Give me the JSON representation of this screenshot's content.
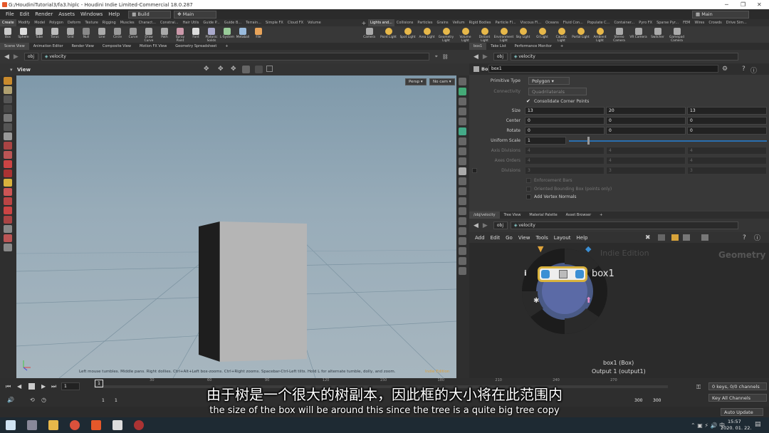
{
  "window": {
    "title": "G:/HoudiniTutorial3/fa3.hiplc - Houdini Indie Limited-Commercial 18.0.287"
  },
  "menu": {
    "items": [
      "File",
      "Edit",
      "Render",
      "Assets",
      "Windows",
      "Help"
    ],
    "build_desktop": "Build",
    "main_desktop": "Main",
    "main_desktop_right": "Main"
  },
  "shelf_tabs_left": [
    "Create",
    "Modify",
    "Model",
    "Polygon",
    "Deform",
    "Texture",
    "Rigging",
    "Muscles",
    "Charact...",
    "Constrai...",
    "Hair Utils",
    "Guide P...",
    "Guide B...",
    "Terrain...",
    "Simple FX",
    "Cloud FX",
    "Volume"
  ],
  "shelf_tabs_right": [
    "Lights and...",
    "Collisions",
    "Particles",
    "Grains",
    "Vellum",
    "Rigid Bodies",
    "Particle Fl...",
    "Viscous Fl...",
    "Oceans",
    "Fluid Con...",
    "Populate C...",
    "Container...",
    "Pyro FX",
    "Sparse Pyr...",
    "FEM",
    "Wires",
    "Crowds",
    "Drive Sim..."
  ],
  "shelf_tools": [
    "Box",
    "Sphere",
    "Tube",
    "Torus",
    "Grid",
    "Null",
    "Line",
    "Circle",
    "Curve",
    "Draw Curve",
    "Path",
    "Spray Paint",
    "Font",
    "Platonic Solids",
    "L-System",
    "Metaball",
    "File"
  ],
  "light_tools": [
    "Camera",
    "Point Light",
    "Spot Light",
    "Area Light",
    "Geometry Light",
    "Volume Light",
    "Distant Light",
    "Environment Light",
    "Sky Light",
    "GI Light",
    "Caustic Light",
    "Portal Light",
    "Ambient Light",
    "Stereo Camera",
    "VR Camera",
    "Switcher",
    "Gamepad Camera"
  ],
  "viewer": {
    "tabs": [
      "Scene View",
      "Animation Editor",
      "Render View",
      "Composite View",
      "Motion FX View",
      "Geometry Spreadsheet"
    ],
    "path_obj": "obj",
    "path_node": "velocity",
    "title": "View",
    "persp": "Persp",
    "cam": "No cam",
    "status": "Left mouse tumbles. Middle pans. Right dollies. Ctrl+Alt+Left box-zooms. Ctrl+Right zooms. Spacebar-Ctrl-Left tilts. Hold L for alternate tumble, dolly, and zoom.",
    "indie": "Indie Edition"
  },
  "params": {
    "tabs": [
      "box1",
      "Take List",
      "Performance Monitor"
    ],
    "path_obj": "obj",
    "path_node": "velocity",
    "node_type": "Box",
    "node_name": "box1",
    "primitive_type_label": "Primitive Type",
    "primitive_type_value": "Polygon",
    "connectivity_label": "Connectivity",
    "connectivity_value": "Quadrilaterals",
    "consolidate_label": "Consolidate Corner Points",
    "size_label": "Size",
    "size": [
      "13",
      "20",
      "13"
    ],
    "center_label": "Center",
    "center": [
      "0",
      "0",
      "0"
    ],
    "rotate_label": "Rotate",
    "rotate": [
      "0",
      "0",
      "0"
    ],
    "uniform_scale_label": "Uniform Scale",
    "uniform_scale": "1",
    "axis_divisions_label": "Axis Divisions",
    "axis_divisions": [
      "4",
      "4",
      "4"
    ],
    "axes_orders_label": "Axes Orders",
    "axes_orders": [
      "4",
      "4",
      "4"
    ],
    "divisions_label": "Divisions",
    "divisions": [
      "3",
      "3",
      "3"
    ],
    "enforcement_bars": "Enforcement Bars",
    "oriented_bbox": "Oriented Bounding Box (points only)",
    "add_vertex_normals": "Add Vertex Normals"
  },
  "network": {
    "tabs": [
      "/obj/velocity",
      "Tree View",
      "Material Palette",
      "Asset Browser"
    ],
    "path_obj": "obj",
    "path_node": "velocity",
    "menu": [
      "Add",
      "Edit",
      "Go",
      "View",
      "Tools",
      "Layout",
      "Help"
    ],
    "context_label": "Geometry",
    "indie": "Indie Edition",
    "node_label": "box1",
    "node_info_1": "box1 (Box)",
    "node_info_2": "Output 1 (output1)"
  },
  "timeline": {
    "frame": "1",
    "start": "1",
    "start2": "1",
    "end": "300",
    "end2": "300",
    "ticks": [
      "1",
      "30",
      "60",
      "90",
      "120",
      "150",
      "180",
      "210",
      "240",
      "270"
    ],
    "keys_channels": "0 keys, 0/0 channels",
    "key_all_channels": "Key All Channels",
    "auto_update": "Auto Update"
  },
  "subtitle": {
    "zh": "由于树是一个很大的树副本，因此框的大小将在此范围内",
    "en": "the size of the box will be around this since the tree is a quite big tree copy"
  },
  "taskbar": {
    "time": "15:57",
    "date": "2020. 01. 22."
  },
  "colors": {
    "accent": "#e7b84a",
    "node_blue": "#3b8fd4",
    "ring": "#222222"
  }
}
